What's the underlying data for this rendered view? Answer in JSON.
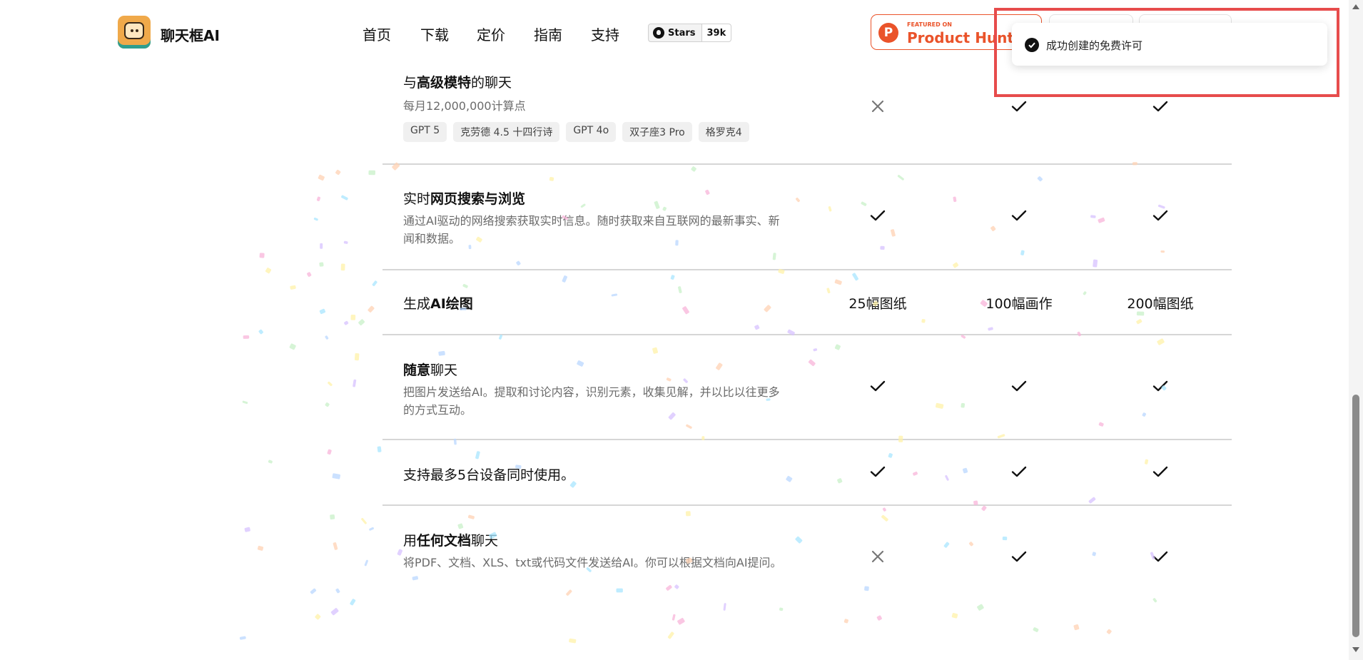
{
  "header": {
    "brand": "聊天框AI",
    "nav": [
      "首页",
      "下载",
      "定价",
      "指南",
      "支持"
    ],
    "github_stars_label": "Stars",
    "github_stars_count": "39k",
    "producthunt_small": "FEATURED ON",
    "producthunt_big": "Product Hunt"
  },
  "toast": {
    "message": "成功创建的免费许可",
    "icon": "check-circle-icon"
  },
  "features": [
    {
      "title_pre": "与",
      "title_bold": "高级模特",
      "title_post": "的聊天",
      "desc": "每月12,000,000计算点",
      "chips": [
        "GPT 5",
        "克劳德 4.5 十四行诗",
        "GPT 4o",
        "双子座3 Pro",
        "格罗克4"
      ],
      "values": [
        "cross",
        "check",
        "check"
      ]
    },
    {
      "title_pre": "实时",
      "title_bold": "网页搜索与浏览",
      "title_post": "",
      "desc": "通过AI驱动的网络搜索获取实时信息。随时获取来自互联网的最新事实、新闻和数据。",
      "values": [
        "check",
        "check",
        "check"
      ]
    },
    {
      "title_pre": "生成",
      "title_bold": "AI绘图",
      "title_post": "",
      "desc": "",
      "values": [
        "25幅图纸",
        "100幅画作",
        "200幅图纸"
      ]
    },
    {
      "title_pre": "",
      "title_bold": "随意",
      "title_post": "聊天",
      "desc": "把图片发送给AI。提取和讨论内容，识别元素，收集见解，并以比以往更多的方式互动。",
      "values": [
        "check",
        "check",
        "check"
      ]
    },
    {
      "title_pre": "支持最多5台设备同时使用。",
      "title_bold": "",
      "title_post": "",
      "desc": "",
      "values": [
        "check",
        "check",
        "check"
      ]
    },
    {
      "title_pre": "用",
      "title_bold": "任何文档",
      "title_post": "聊天",
      "desc": "将PDF、文档、XLS、txt或代码文件发送给AI。你可以根据文档向AI提问。",
      "values": [
        "cross",
        "check",
        "check"
      ]
    }
  ],
  "colors": {
    "accent_producthunt": "#ea532a",
    "highlight_box": "#e74c4c",
    "separator": "#d6d6d6",
    "desc_text": "#6b6b6b"
  }
}
